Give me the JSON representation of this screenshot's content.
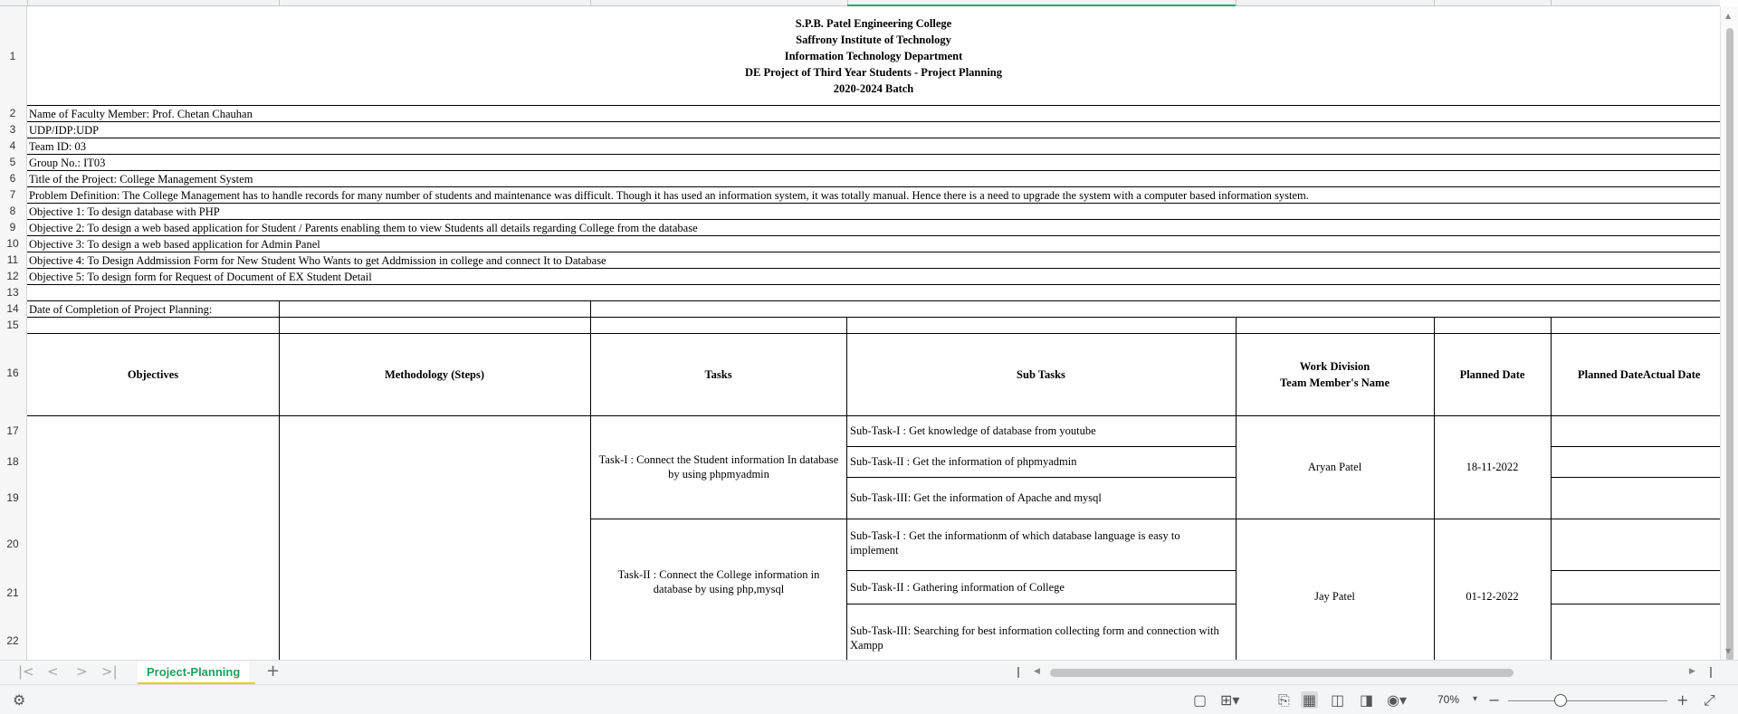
{
  "sheet": {
    "header_lines": [
      "S.P.B. Patel Engineering College",
      "Saffrony Institute of Technology",
      "Information Technology Department",
      "DE Project of Third Year Students  - Project Planning",
      "2020-2024 Batch"
    ],
    "info_rows": [
      "Name of Faculty Member:  Prof. Chetan Chauhan",
      "UDP/IDP:UDP",
      "Team ID: 03",
      "Group No.: IT03",
      "Title of the Project: College Management System",
      "Problem Definition: The College Management has to handle records for many number of students and maintenance was difficult. Though it has used an information system, it was totally manual. Hence there is a need to upgrade the system with a computer based information system.",
      "Objective 1:  To design database with PHP",
      "Objective 2: To design a web based application for Student / Parents  enabling them to view Students all details regarding College from the database",
      "Objective 3: To design a web based application for Admin Panel",
      "Objective 4: To Design Addmission Form for New Student Who Wants to get Addmission in college and connect It to Database",
      "Objective 5: To design form for Request of Document of EX Student Detail"
    ],
    "completion_label": "Date of Completion of Project Planning:",
    "table_headers": {
      "objectives": "Objectives",
      "methodology": "Methodology (Steps)",
      "tasks": "Tasks",
      "subtasks": "Sub Tasks",
      "work_division_1": "Work Division",
      "work_division_2": "Team Member's Name",
      "planned_date": "Planned Date",
      "actual_date": "Planned DateActual Date"
    },
    "task_1": {
      "task": "Task-I : Connect the Student information In database by using phpmyadmin",
      "subtasks": [
        "Sub-Task-I : Get knowledge of database from youtube",
        "Sub-Task-II :  Get the information of phpmyadmin",
        "Sub-Task-III: Get the information of Apache and mysql"
      ],
      "member": "Aryan Patel",
      "planned_date": "18-11-2022"
    },
    "task_2": {
      "task": "Task-II : Connect the College information in database by using php,mysql",
      "subtasks": [
        "Sub-Task-I : Get the informationm of which database language is easy to implement",
        "Sub-Task-II : Gathering information of College",
        "Sub-Task-III: Searching for best information collecting form and connection with Xampp"
      ],
      "member": "Jay Patel",
      "planned_date": "01-12-2022"
    },
    "row_numbers": [
      "1",
      "2",
      "3",
      "4",
      "5",
      "6",
      "7",
      "8",
      "9",
      "10",
      "11",
      "12",
      "13",
      "14",
      "15",
      "16",
      "17",
      "18",
      "19",
      "20",
      "21",
      "22"
    ]
  },
  "tabs": {
    "active_sheet": "Project-Planning",
    "add_sheet_icon": "plus-icon"
  },
  "status": {
    "zoom": "70%",
    "zoom_level": 0.3
  },
  "colors": {
    "accent": "#1ea05a",
    "tab_underline": "#e2d11c"
  }
}
